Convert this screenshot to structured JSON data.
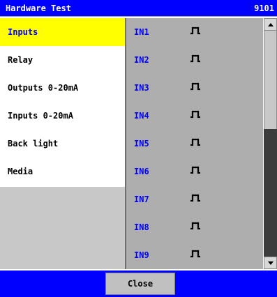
{
  "window": {
    "title": "Hardware Test",
    "code": "9101"
  },
  "menu": {
    "items": [
      {
        "label": "Inputs",
        "active": true
      },
      {
        "label": "Relay",
        "active": false
      },
      {
        "label": "Outputs 0-20mA",
        "active": false
      },
      {
        "label": "Inputs 0-20mA",
        "active": false
      },
      {
        "label": "Back light",
        "active": false
      },
      {
        "label": "Media",
        "active": false
      }
    ]
  },
  "inputs": [
    {
      "label": "IN1",
      "icon": "pulse-icon"
    },
    {
      "label": "IN2",
      "icon": "pulse-icon"
    },
    {
      "label": "IN3",
      "icon": "pulse-icon"
    },
    {
      "label": "IN4",
      "icon": "pulse-icon"
    },
    {
      "label": "IN5",
      "icon": "pulse-icon"
    },
    {
      "label": "IN6",
      "icon": "pulse-icon"
    },
    {
      "label": "IN7",
      "icon": "pulse-icon"
    },
    {
      "label": "IN8",
      "icon": "pulse-icon"
    },
    {
      "label": "IN9",
      "icon": "pulse-icon"
    }
  ],
  "footer": {
    "close_label": "Close"
  },
  "colors": {
    "title_bar": "#0000ff",
    "menu_active_bg": "#ffff00",
    "menu_active_text": "#0000ff",
    "input_label": "#0000ff",
    "list_bg": "#aeaeae"
  }
}
